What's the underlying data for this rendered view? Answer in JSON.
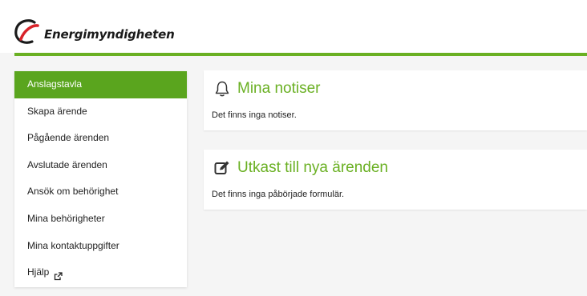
{
  "header": {
    "logo_text": "Energimyndigheten",
    "accent_color": "#6ab023"
  },
  "sidebar": {
    "items": [
      {
        "label": "Anslagstavla",
        "active": true
      },
      {
        "label": "Skapa ärende"
      },
      {
        "label": "Pågående ärenden"
      },
      {
        "label": "Avslutade ärenden"
      },
      {
        "label": "Ansök om behörighet"
      },
      {
        "label": "Mina behörigheter"
      },
      {
        "label": "Mina kontaktuppgifter"
      },
      {
        "label": "Hjälp",
        "icon": "external-link-icon"
      }
    ],
    "active_color": "#5aa51e"
  },
  "main": {
    "notiser": {
      "title": "Mina notiser",
      "icon": "bell-icon",
      "text": "Det finns inga notiser."
    },
    "utkast": {
      "title": "Utkast till nya ärenden",
      "icon": "edit-icon",
      "text": "Det finns inga påbörjade formulär."
    }
  }
}
